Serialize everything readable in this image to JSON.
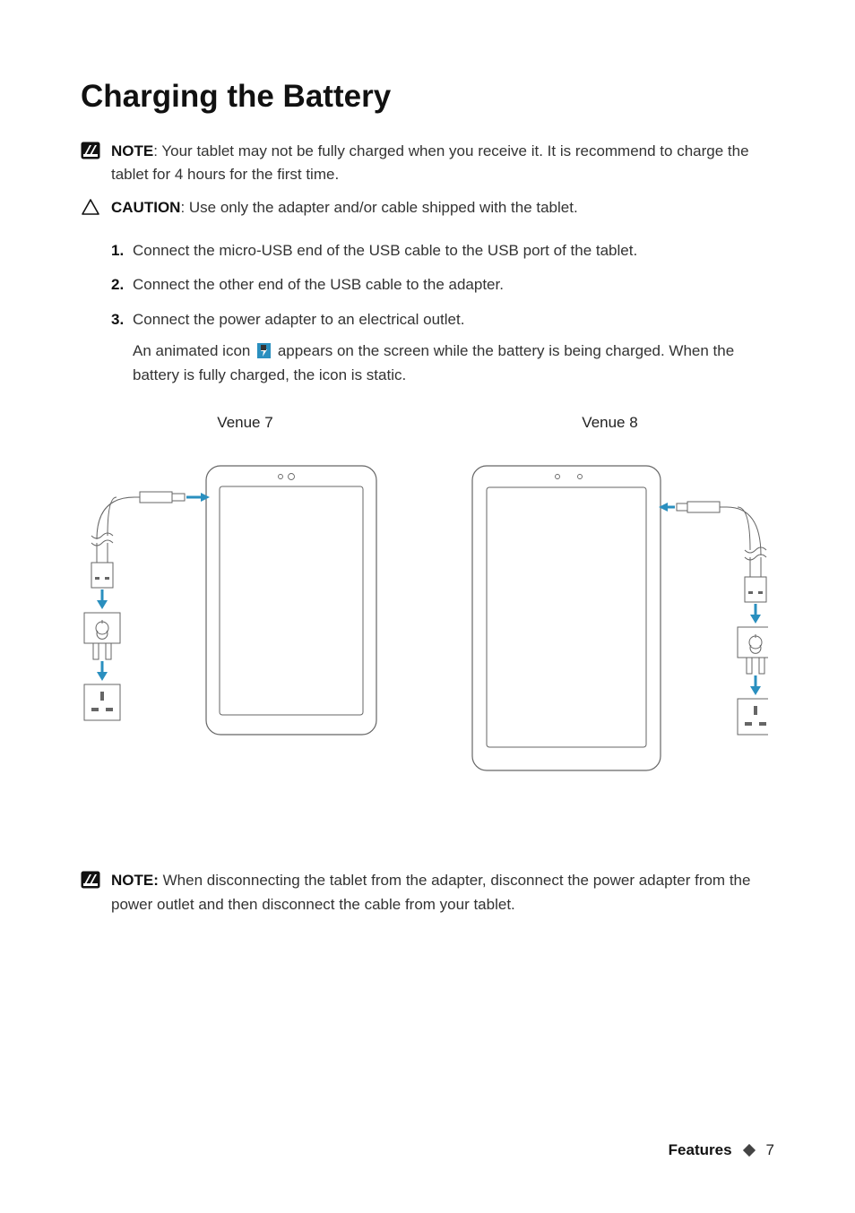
{
  "heading": "Charging the Battery",
  "note1": {
    "label": "NOTE",
    "text": ": Your tablet may not be fully charged when you receive it. It is recommend to charge the tablet for 4 hours for the first time."
  },
  "caution": {
    "label": "CAUTION",
    "text": ": Use only the adapter and/or cable shipped with the tablet."
  },
  "steps": [
    "Connect the micro-USB end of the USB cable to the USB port of the tablet.",
    "Connect the other end of the USB cable to the adapter.",
    "Connect the power adapter to an electrical outlet."
  ],
  "step3_sub_a": "An animated icon ",
  "step3_sub_b": " appears on the screen while the battery is being charged. When the battery is fully charged, the icon is static.",
  "diagram_labels": {
    "left": "Venue 7",
    "right": "Venue 8"
  },
  "note2": {
    "label": "NOTE:",
    "text": " When disconnecting the tablet from the adapter, disconnect the power adapter from the power outlet and then disconnect the cable from your tablet."
  },
  "footer": {
    "section": "Features",
    "page": "7"
  }
}
